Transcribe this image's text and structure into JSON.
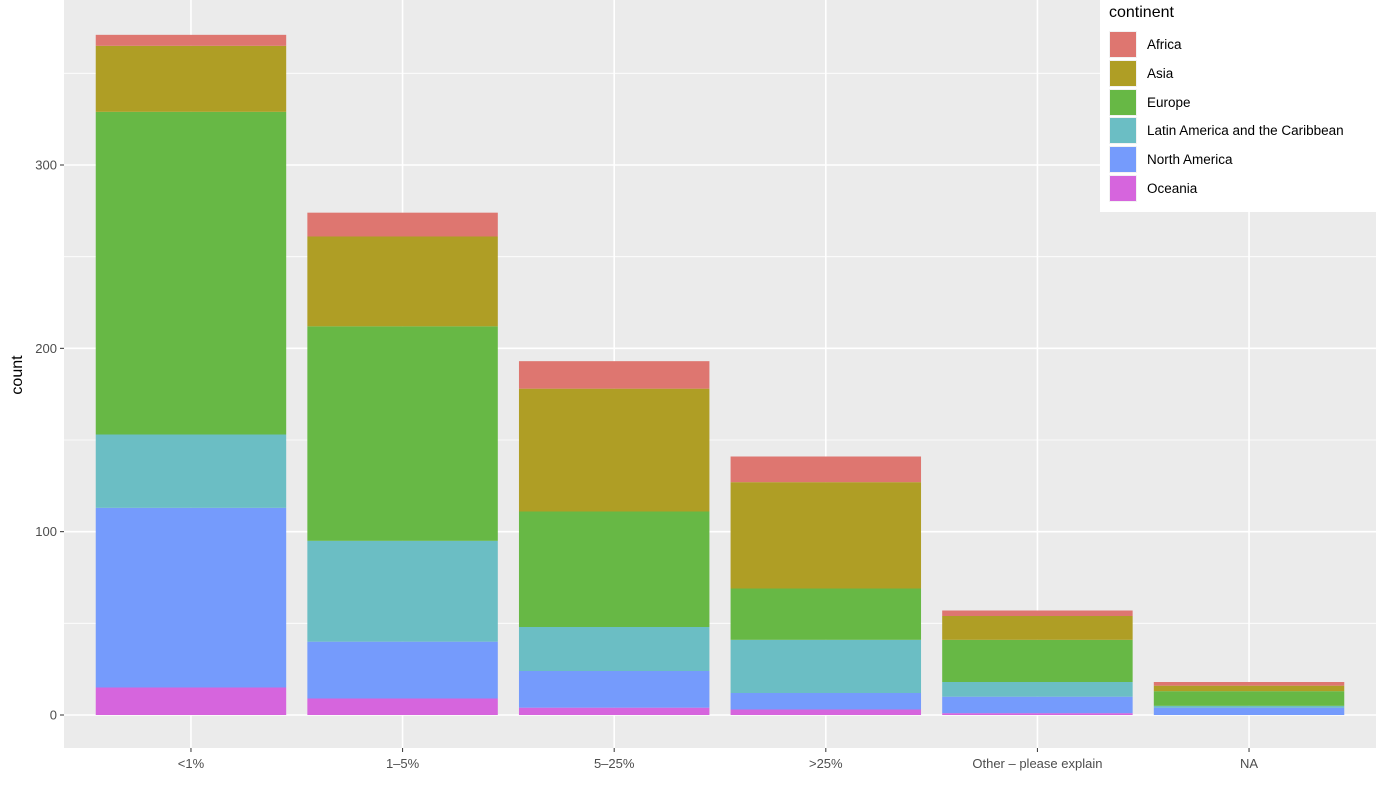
{
  "chart_data": {
    "type": "bar",
    "stacked": true,
    "title": "",
    "xlabel": "",
    "ylabel": "count",
    "ylim": [
      -18,
      390
    ],
    "yticks": [
      0,
      100,
      200,
      300
    ],
    "yminor": [
      50,
      150,
      250,
      350
    ],
    "grid": true,
    "legend_position": "top-right",
    "legend_title": "continent",
    "categories": [
      "<1%",
      "1–5%",
      "5–25%",
      ">25%",
      "Other – please explain",
      "NA"
    ],
    "series": [
      {
        "name": "Africa",
        "color": "#DE7670",
        "values": [
          6,
          13,
          15,
          14,
          3,
          2
        ]
      },
      {
        "name": "Asia",
        "color": "#AF9E25",
        "values": [
          36,
          49,
          67,
          58,
          13,
          3
        ]
      },
      {
        "name": "Europe",
        "color": "#67B845",
        "values": [
          176,
          117,
          63,
          28,
          23,
          8
        ]
      },
      {
        "name": "Latin America and the Caribbean",
        "color": "#6BBEC4",
        "values": [
          40,
          55,
          24,
          29,
          8,
          1
        ]
      },
      {
        "name": "North America",
        "color": "#759BFC",
        "values": [
          98,
          31,
          20,
          9,
          9,
          4
        ]
      },
      {
        "name": "Oceania",
        "color": "#D665DD",
        "values": [
          15,
          9,
          4,
          3,
          1,
          0
        ]
      }
    ],
    "totals": [
      371,
      274,
      193,
      141,
      57,
      18
    ]
  },
  "colors": {
    "panel_background": "#EBEBEB",
    "gridline": "#FFFFFF",
    "tick_text": "#4D4D4D"
  }
}
